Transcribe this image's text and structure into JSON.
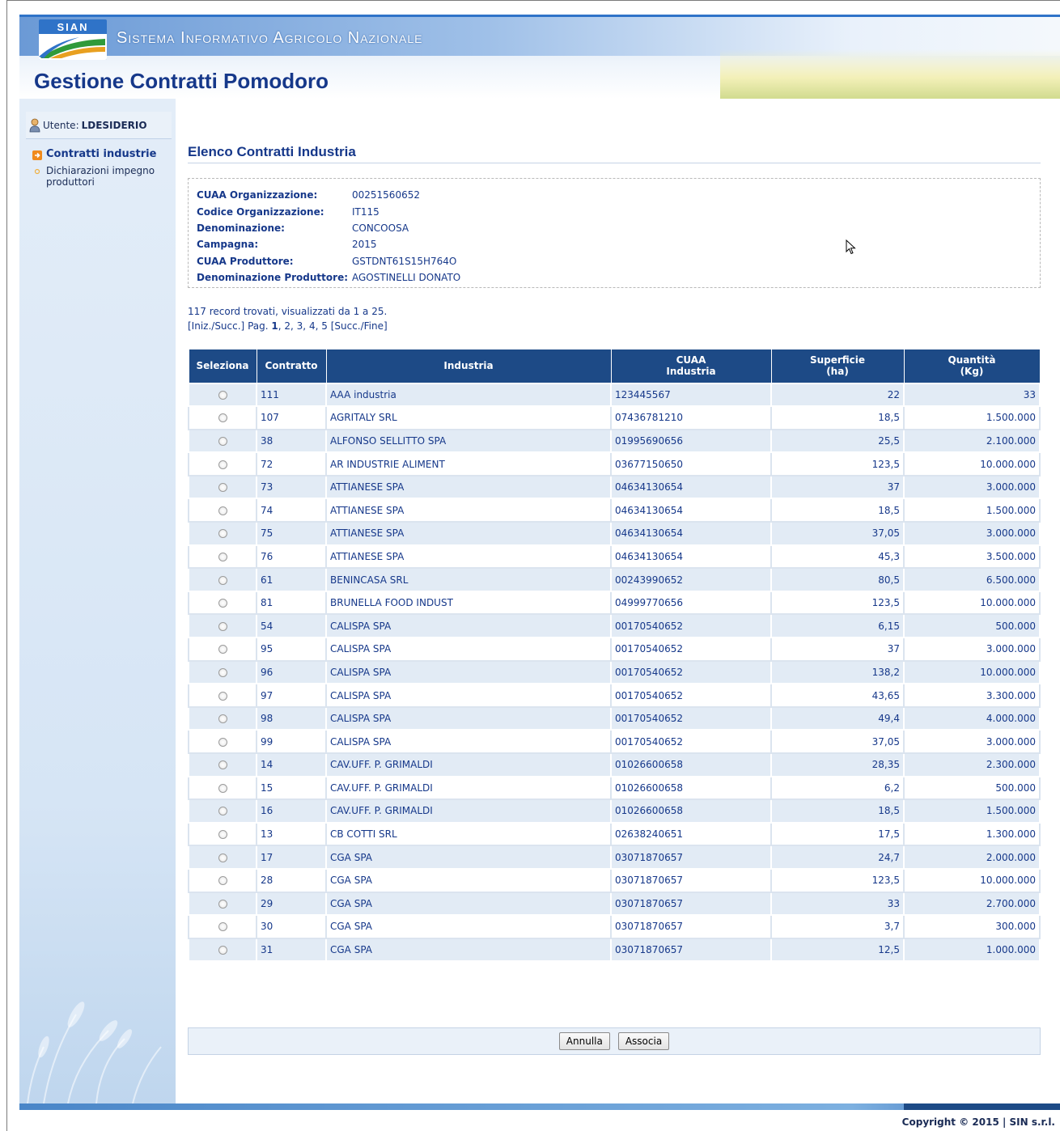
{
  "header": {
    "logo_text": "SIAN",
    "system_name": "Sistema Informativo Agricolo Nazionale",
    "app_title": "Gestione Contratti Pomodoro"
  },
  "sidebar": {
    "user_label": "Utente:",
    "user_name": "LDESIDERIO",
    "menu": [
      {
        "label": "Contratti industrie",
        "active": true
      },
      {
        "label": "Dichiarazioni impegno produttori",
        "active": false
      }
    ]
  },
  "main": {
    "title": "Elenco Contratti Industria",
    "info": [
      {
        "label": "CUAA Organizzazione:",
        "value": "00251560652"
      },
      {
        "label": "Codice Organizzazione:",
        "value": "IT115"
      },
      {
        "label": "Denominazione:",
        "value": "CONCOOSA"
      },
      {
        "label": "Campagna:",
        "value": "2015"
      },
      {
        "label": "CUAA Produttore:",
        "value": "GSTDNT61S15H764O"
      },
      {
        "label": "Denominazione Produttore:",
        "value": "AGOSTINELLI DONATO"
      }
    ],
    "records_text": "117 record trovati, visualizzati da 1 a 25.",
    "pager": {
      "first_prev": "[Iniz./Succ.]",
      "pag_label": "Pag.",
      "current": "1",
      "pages": [
        "2",
        "3",
        "4",
        "5"
      ],
      "next_last": "[Succ./Fine]"
    },
    "table": {
      "headers": {
        "select": "Seleziona",
        "contract": "Contratto",
        "industry": "Industria",
        "cuaa_1": "CUAA",
        "cuaa_2": "Industria",
        "area_1": "Superficie",
        "area_2": "(ha)",
        "qty_1": "Quantità",
        "qty_2": "(Kg)"
      },
      "rows": [
        {
          "contratto": "111",
          "industria": "AAA industria",
          "cuaa": "123445567",
          "superficie": "22",
          "quantita": "33"
        },
        {
          "contratto": "107",
          "industria": "AGRITALY SRL",
          "cuaa": "07436781210",
          "superficie": "18,5",
          "quantita": "1.500.000"
        },
        {
          "contratto": "38",
          "industria": "ALFONSO SELLITTO SPA",
          "cuaa": "01995690656",
          "superficie": "25,5",
          "quantita": "2.100.000"
        },
        {
          "contratto": "72",
          "industria": "AR INDUSTRIE ALIMENT",
          "cuaa": "03677150650",
          "superficie": "123,5",
          "quantita": "10.000.000"
        },
        {
          "contratto": "73",
          "industria": "ATTIANESE SPA",
          "cuaa": "04634130654",
          "superficie": "37",
          "quantita": "3.000.000"
        },
        {
          "contratto": "74",
          "industria": "ATTIANESE SPA",
          "cuaa": "04634130654",
          "superficie": "18,5",
          "quantita": "1.500.000"
        },
        {
          "contratto": "75",
          "industria": "ATTIANESE SPA",
          "cuaa": "04634130654",
          "superficie": "37,05",
          "quantita": "3.000.000"
        },
        {
          "contratto": "76",
          "industria": "ATTIANESE SPA",
          "cuaa": "04634130654",
          "superficie": "45,3",
          "quantita": "3.500.000"
        },
        {
          "contratto": "61",
          "industria": "BENINCASA SRL",
          "cuaa": "00243990652",
          "superficie": "80,5",
          "quantita": "6.500.000"
        },
        {
          "contratto": "81",
          "industria": "BRUNELLA FOOD INDUST",
          "cuaa": "04999770656",
          "superficie": "123,5",
          "quantita": "10.000.000"
        },
        {
          "contratto": "54",
          "industria": "CALISPA SPA",
          "cuaa": "00170540652",
          "superficie": "6,15",
          "quantita": "500.000"
        },
        {
          "contratto": "95",
          "industria": "CALISPA SPA",
          "cuaa": "00170540652",
          "superficie": "37",
          "quantita": "3.000.000"
        },
        {
          "contratto": "96",
          "industria": "CALISPA SPA",
          "cuaa": "00170540652",
          "superficie": "138,2",
          "quantita": "10.000.000"
        },
        {
          "contratto": "97",
          "industria": "CALISPA SPA",
          "cuaa": "00170540652",
          "superficie": "43,65",
          "quantita": "3.300.000"
        },
        {
          "contratto": "98",
          "industria": "CALISPA SPA",
          "cuaa": "00170540652",
          "superficie": "49,4",
          "quantita": "4.000.000"
        },
        {
          "contratto": "99",
          "industria": "CALISPA SPA",
          "cuaa": "00170540652",
          "superficie": "37,05",
          "quantita": "3.000.000"
        },
        {
          "contratto": "14",
          "industria": "CAV.UFF. P. GRIMALDI",
          "cuaa": "01026600658",
          "superficie": "28,35",
          "quantita": "2.300.000"
        },
        {
          "contratto": "15",
          "industria": "CAV.UFF. P. GRIMALDI",
          "cuaa": "01026600658",
          "superficie": "6,2",
          "quantita": "500.000"
        },
        {
          "contratto": "16",
          "industria": "CAV.UFF. P. GRIMALDI",
          "cuaa": "01026600658",
          "superficie": "18,5",
          "quantita": "1.500.000"
        },
        {
          "contratto": "13",
          "industria": "CB COTTI SRL",
          "cuaa": "02638240651",
          "superficie": "17,5",
          "quantita": "1.300.000"
        },
        {
          "contratto": "17",
          "industria": "CGA SPA",
          "cuaa": "03071870657",
          "superficie": "24,7",
          "quantita": "2.000.000"
        },
        {
          "contratto": "28",
          "industria": "CGA SPA",
          "cuaa": "03071870657",
          "superficie": "123,5",
          "quantita": "10.000.000"
        },
        {
          "contratto": "29",
          "industria": "CGA SPA",
          "cuaa": "03071870657",
          "superficie": "33",
          "quantita": "2.700.000"
        },
        {
          "contratto": "30",
          "industria": "CGA SPA",
          "cuaa": "03071870657",
          "superficie": "3,7",
          "quantita": "300.000"
        },
        {
          "contratto": "31",
          "industria": "CGA SPA",
          "cuaa": "03071870657",
          "superficie": "12,5",
          "quantita": "1.000.000"
        }
      ]
    },
    "buttons": {
      "cancel": "Annulla",
      "associate": "Associa"
    }
  },
  "footer": {
    "copyright": "Copyright © 2015 | SIN s.r.l."
  },
  "colors": {
    "header_blue": "#1d4a86",
    "title_blue": "#16388a",
    "row_alt": "#e2ebf5",
    "menu_orange": "#f08a1c"
  }
}
